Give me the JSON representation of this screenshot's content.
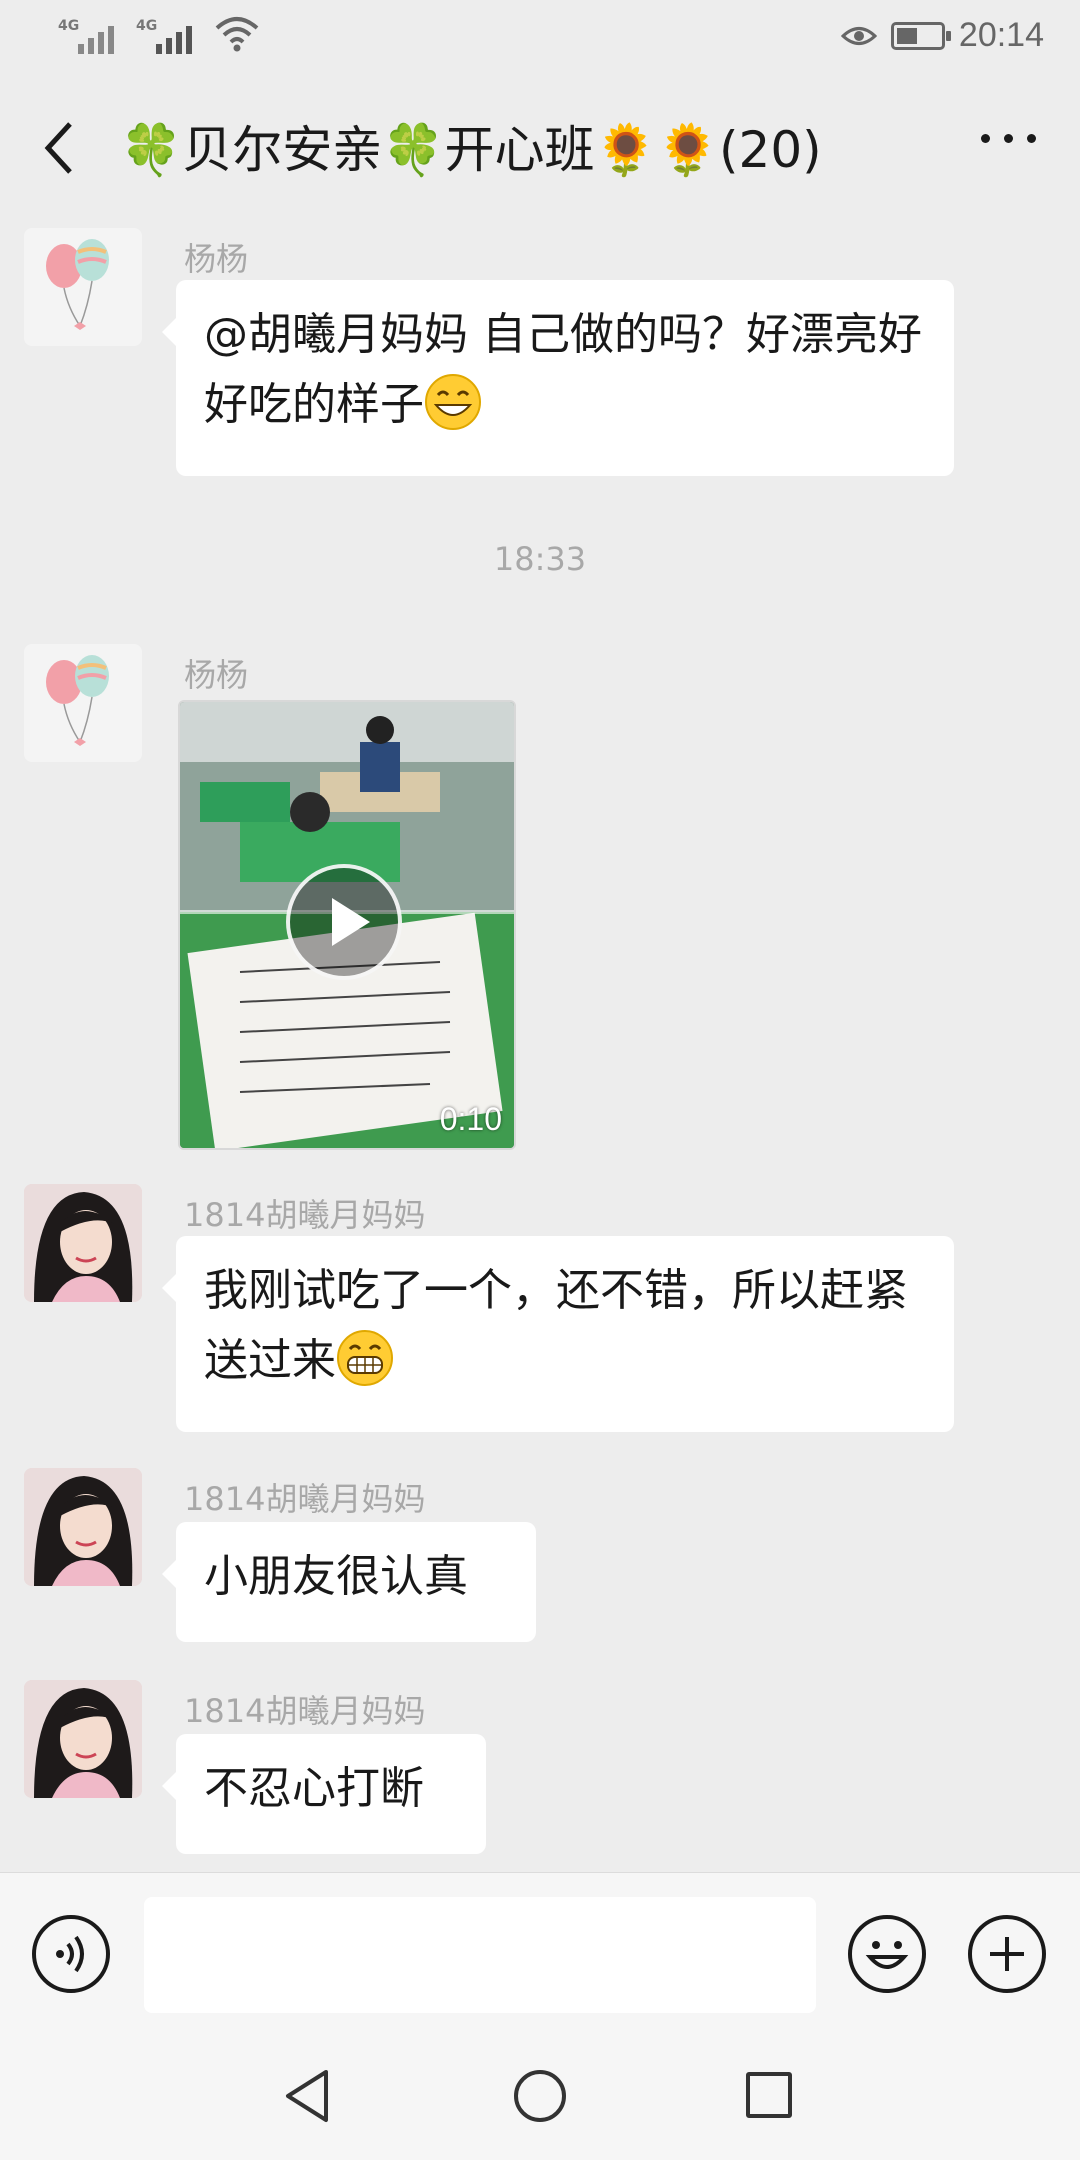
{
  "status_bar": {
    "signal_1_label": "4G",
    "signal_2_label": "4G",
    "time": "20:14"
  },
  "header": {
    "title": "🍀贝尔安亲🍀开心班🌻🌻(20)"
  },
  "messages": [
    {
      "sender": "杨杨",
      "text": "@胡曦月妈妈  自己做的吗？好漂亮好好吃的样子",
      "emoji": "smile-emoji"
    },
    {
      "sender": "杨杨",
      "type": "video",
      "duration": "0:10"
    },
    {
      "sender": "1814胡曦月妈妈",
      "text": "我刚试吃了一个，还不错，所以赶紧送过来",
      "emoji": "grin-emoji"
    },
    {
      "sender": "1814胡曦月妈妈",
      "text": "小朋友很认真"
    },
    {
      "sender": "1814胡曦月妈妈",
      "text": "不忍心打断"
    }
  ],
  "timestamp": "18:33",
  "input": {
    "placeholder": ""
  },
  "icons": {
    "back": "chevron-left-icon",
    "more": "more-dots-icon",
    "voice": "voice-icon",
    "emoji": "emoji-icon",
    "plus": "plus-icon"
  },
  "colors": {
    "background": "#ededed",
    "bubble": "#ffffff",
    "sender": "#a8a8a8"
  }
}
